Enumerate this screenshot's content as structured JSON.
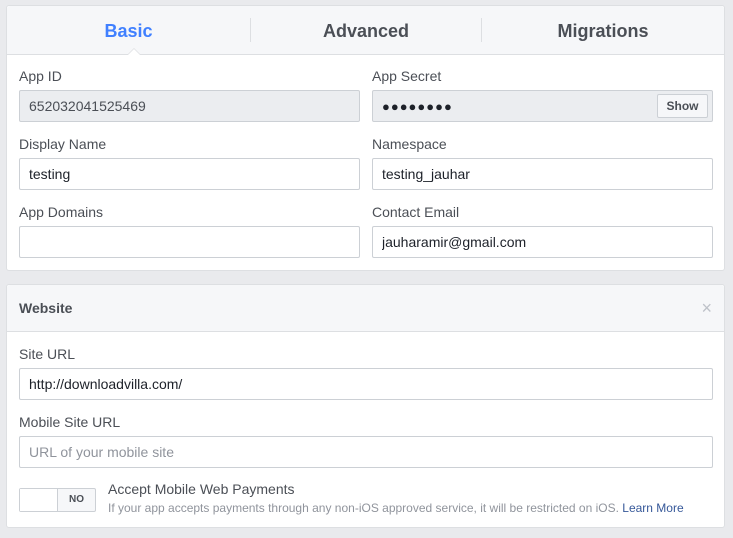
{
  "tabs": [
    {
      "label": "Basic",
      "active": true
    },
    {
      "label": "Advanced",
      "active": false
    },
    {
      "label": "Migrations",
      "active": false
    }
  ],
  "basic": {
    "app_id_label": "App ID",
    "app_id_value": "652032041525469",
    "app_secret_label": "App Secret",
    "app_secret_value": "●●●●●●●●",
    "show_label": "Show",
    "display_name_label": "Display Name",
    "display_name_value": "testing",
    "namespace_label": "Namespace",
    "namespace_value": "testing_jauhar",
    "app_domains_label": "App Domains",
    "app_domains_value": "",
    "contact_email_label": "Contact Email",
    "contact_email_value": "jauharamir@gmail.com"
  },
  "website": {
    "title": "Website",
    "close_icon": "×",
    "site_url_label": "Site URL",
    "site_url_value": "http://downloadvilla.com/",
    "mobile_site_url_label": "Mobile Site URL",
    "mobile_site_url_placeholder": "URL of your mobile site",
    "toggle_state": "NO",
    "payments_label": "Accept Mobile Web Payments",
    "payments_note": "If your app accepts payments through any non-iOS approved service, it will be restricted on iOS.",
    "learn_more": "Learn More"
  },
  "colors": {
    "accent": "#4080ff",
    "link": "#365899",
    "background": "#e9eaed"
  }
}
